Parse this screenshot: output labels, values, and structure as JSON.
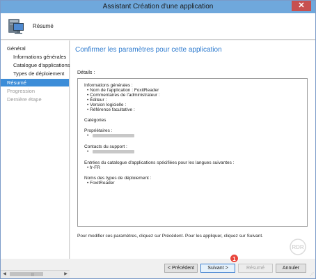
{
  "window": {
    "title": "Assistant Création d'une application",
    "close_glyph": "✕"
  },
  "header": {
    "title": "Résumé",
    "icon": "computer-icon"
  },
  "sidebar": {
    "items": [
      {
        "label": "Général",
        "state": "normal"
      },
      {
        "label": "Informations générales",
        "state": "normal"
      },
      {
        "label": "Catalogue d'applications",
        "state": "normal"
      },
      {
        "label": "Types de déploiement",
        "state": "normal"
      },
      {
        "label": "Résumé",
        "state": "active"
      },
      {
        "label": "Progression",
        "state": "disabled"
      },
      {
        "label": "Dernière étape",
        "state": "disabled"
      }
    ],
    "scroll_left": "◀",
    "scroll_right": "▶",
    "scroll_grip": "|||"
  },
  "content": {
    "heading": "Confirmer les paramètres pour cette application",
    "details_label": "Détails :",
    "details": {
      "general_title": "Informations générales :",
      "general_items": [
        "Nom de l'application : FoxitReader",
        "Commentaires de l'administrateur :",
        "Éditeur :",
        "Version logicielle :",
        "Référence facultative :"
      ],
      "categories_title": "Catégories",
      "owners_title": "Propriétaires :",
      "contacts_title": "Contacts du support :",
      "catalog_title": "Entrées du catalogue d'applications spécifiées pour les langues suivantes :",
      "catalog_items": [
        "fr-FR"
      ],
      "deployment_title": "Noms des types de déploiement :",
      "deployment_items": [
        "FoxitReader"
      ]
    },
    "note": "Pour modifier ces paramètres, cliquez sur Précédent. Pour les appliquer, cliquez sur Suivant."
  },
  "footer": {
    "previous_label": "< Précédent",
    "next_label": "Suivant >",
    "summary_label": "Résumé",
    "cancel_label": "Annuler",
    "step_badge": "1"
  },
  "watermark": {
    "text": "RDR"
  },
  "colors": {
    "accent": "#3c8dd8",
    "heading": "#2e7bcf",
    "titlebar": "#6fa8dc",
    "close": "#c75050",
    "badge": "#e8463c"
  }
}
